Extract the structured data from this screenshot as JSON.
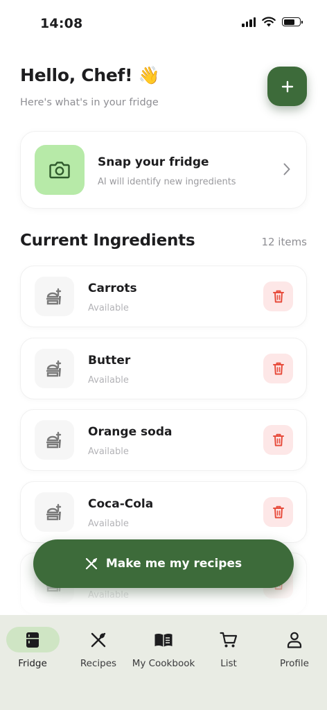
{
  "status_bar": {
    "time": "14:08"
  },
  "header": {
    "greeting": "Hello, Chef! 👋",
    "subtitle": "Here's what's in your fridge"
  },
  "snap_card": {
    "title": "Snap your fridge",
    "subtitle": "AI will identify new ingredients"
  },
  "ingredients_section": {
    "title": "Current Ingredients",
    "count": "12 items",
    "items": [
      {
        "name": "Carrots",
        "status": "Available"
      },
      {
        "name": "Butter",
        "status": "Available"
      },
      {
        "name": "Orange soda",
        "status": "Available"
      },
      {
        "name": "Coca-Cola",
        "status": "Available"
      },
      {
        "name": "",
        "status": "Available"
      }
    ]
  },
  "cta": {
    "label": "Make me my recipes"
  },
  "tab_bar": {
    "tabs": [
      {
        "label": "Fridge",
        "icon": "fridge-icon",
        "active": true
      },
      {
        "label": "Recipes",
        "icon": "utensils-icon",
        "active": false
      },
      {
        "label": "My Cookbook",
        "icon": "book-icon",
        "active": false
      },
      {
        "label": "List",
        "icon": "cart-icon",
        "active": false
      },
      {
        "label": "Profile",
        "icon": "person-icon",
        "active": false
      }
    ]
  },
  "colors": {
    "primary": "#3d6b3a",
    "snap_icon_bg": "#b7eaa8",
    "delete_bg": "#fde7e7",
    "delete_icon": "#e74c3c",
    "tab_bar_bg": "#e9ece4",
    "tab_active_bg": "#cfe5c4"
  }
}
